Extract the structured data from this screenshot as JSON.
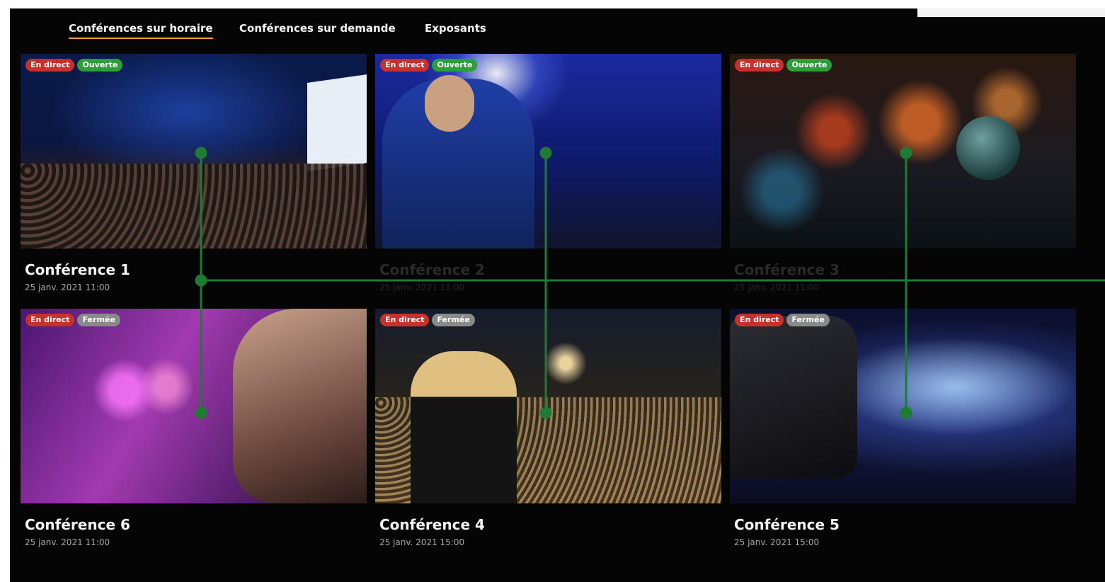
{
  "nav": {
    "tabs": [
      {
        "label": "Conférences sur horaire",
        "active": true
      },
      {
        "label": "Conférences sur demande",
        "active": false
      },
      {
        "label": "Exposants",
        "active": false
      }
    ]
  },
  "badges": {
    "live": "En direct",
    "open": "Ouverte",
    "closed": "Fermée"
  },
  "cards": [
    {
      "title": "Conférence 1",
      "date": "25 janv. 2021 11:00",
      "status": "Ouverte"
    },
    {
      "title": "Conférence 2",
      "date": "25 janv. 2021 11:00",
      "status": "Ouverte"
    },
    {
      "title": "Conférence 3",
      "date": "25 janv. 2021 11:00",
      "status": "Ouverte"
    },
    {
      "title": "Conférence 6",
      "date": "25 janv. 2021 11:00",
      "status": "Fermée"
    },
    {
      "title": "Conférence 4",
      "date": "25 janv. 2021 15:00",
      "status": "Fermée"
    },
    {
      "title": "Conférence 5",
      "date": "25 janv. 2021 15:00",
      "status": "Fermée"
    }
  ],
  "colors": {
    "background": "#050505",
    "accent_underline": "#f0a030",
    "badge_live": "#c9302c",
    "badge_open": "#2e9e3a",
    "badge_closed": "#8a8a8a",
    "overlay_lines": "#1f7a34"
  }
}
